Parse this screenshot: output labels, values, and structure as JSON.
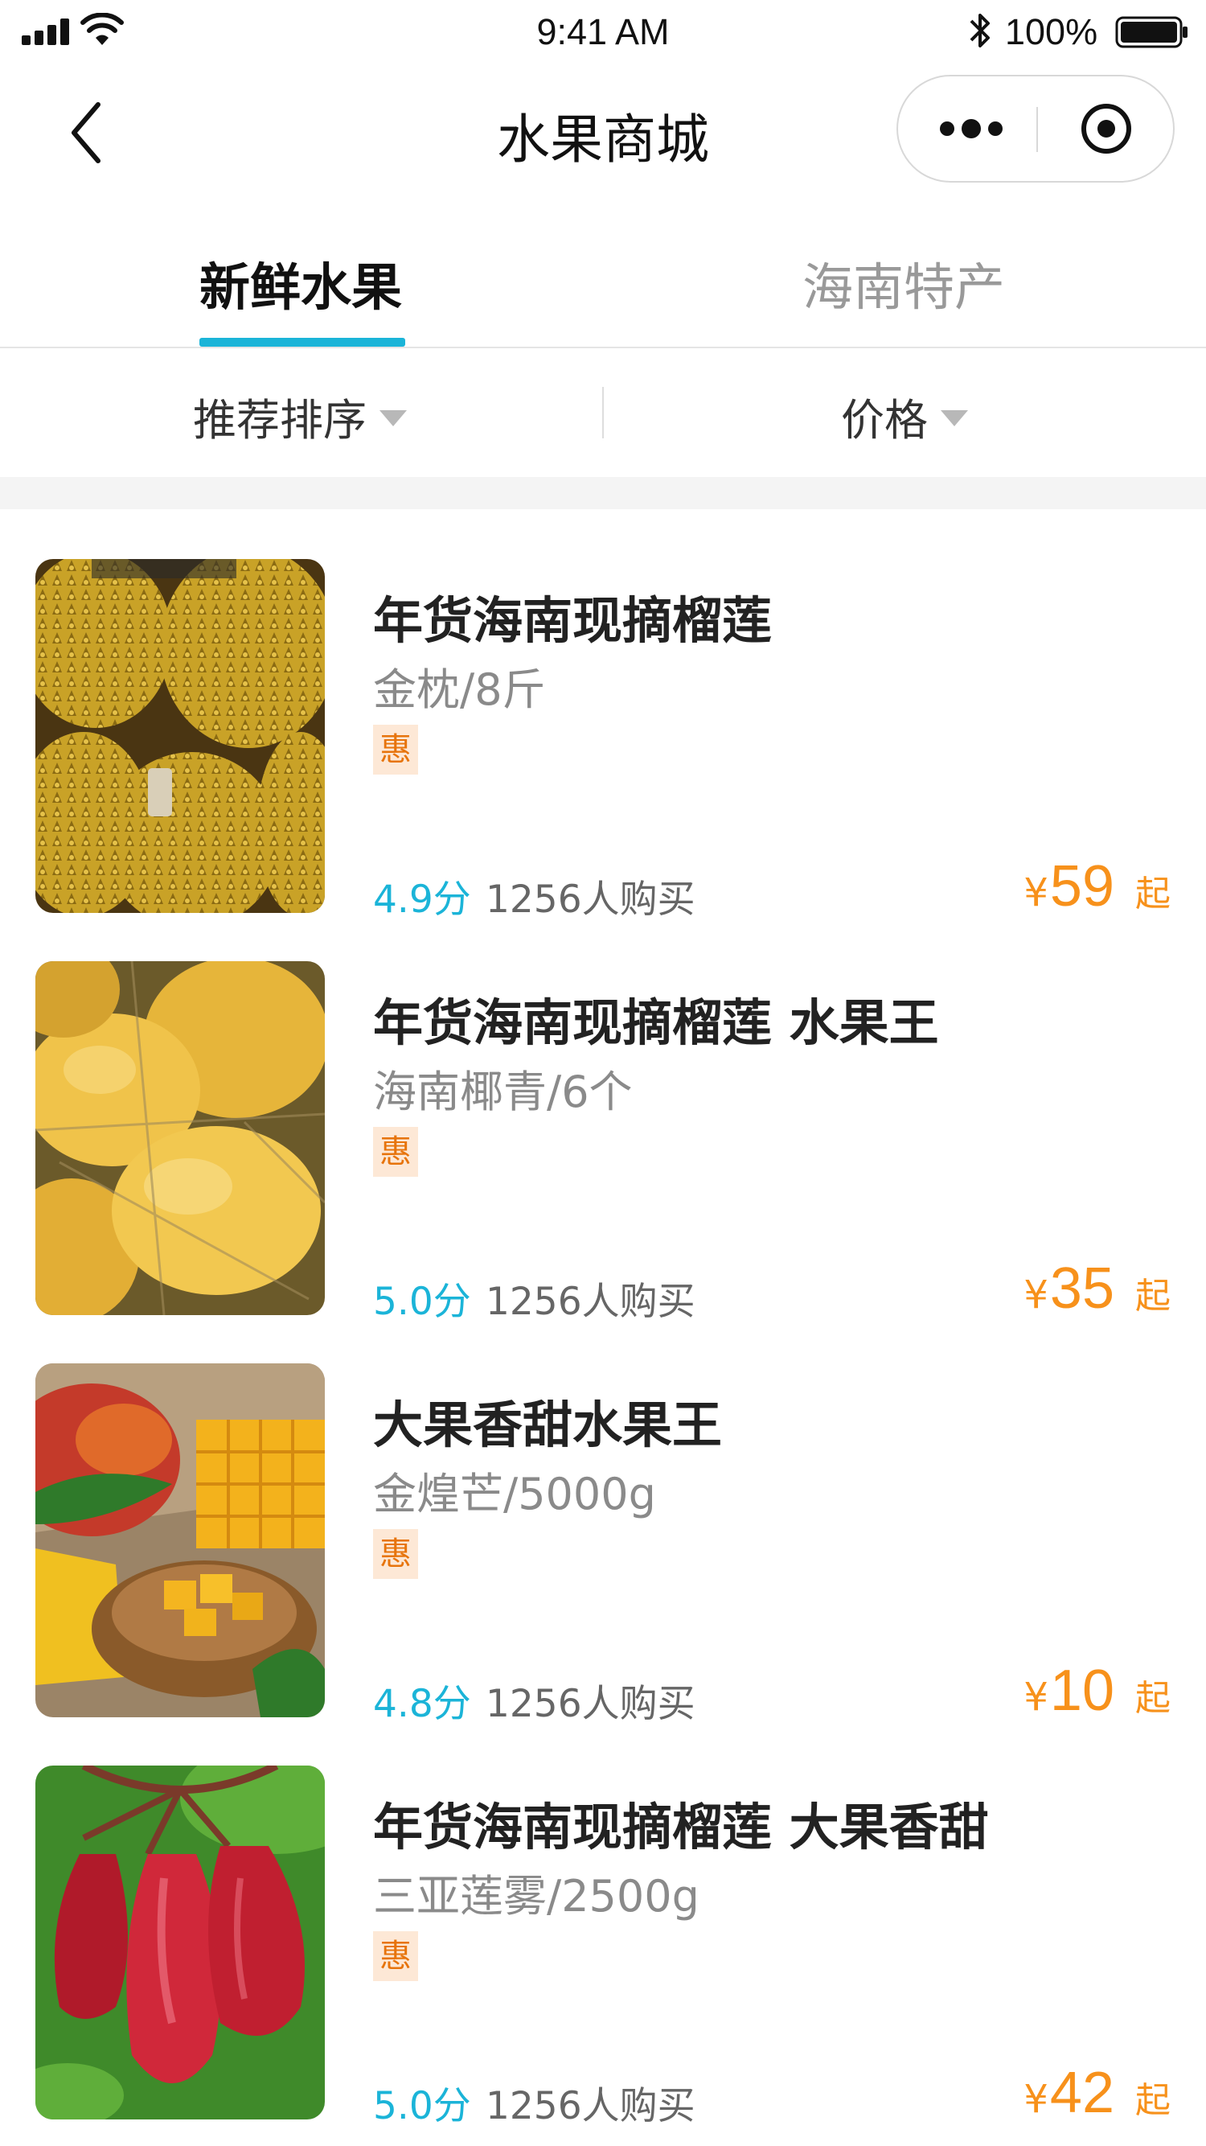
{
  "status_bar": {
    "time": "9:41 AM",
    "battery_percent": "100%",
    "icons": [
      "signal-icon",
      "wifi-icon",
      "bluetooth-icon",
      "battery-icon"
    ]
  },
  "nav": {
    "title": "水果商城",
    "back_icon": "chevron-left-icon",
    "more_icon": "more-dots-icon",
    "close_icon": "target-circle-icon"
  },
  "tabs": [
    {
      "label": "新鲜水果",
      "active": true
    },
    {
      "label": "海南特产",
      "active": false
    }
  ],
  "filters": {
    "sort_label": "推荐排序",
    "price_label": "价格"
  },
  "colors": {
    "accent": "#1bb4d8",
    "price": "#f7911b",
    "tag_bg": "#fde8d6",
    "tag_text": "#e7740c"
  },
  "products": [
    {
      "title": "年货海南现摘榴莲",
      "subtitle": "金枕/8斤",
      "tag": "惠",
      "rating": "4.9分",
      "buyers": "1256人购买",
      "currency": "¥",
      "price": "59",
      "suffix": "起",
      "image": "durian"
    },
    {
      "title": "年货海南现摘榴莲 水果王",
      "subtitle": "海南椰青/6个",
      "tag": "惠",
      "rating": "5.0分",
      "buyers": "1256人购买",
      "currency": "¥",
      "price": "35",
      "suffix": "起",
      "image": "coconut"
    },
    {
      "title": "大果香甜水果王",
      "subtitle": "金煌芒/5000g",
      "tag": "惠",
      "rating": "4.8分",
      "buyers": "1256人购买",
      "currency": "¥",
      "price": "10",
      "suffix": "起",
      "image": "mango"
    },
    {
      "title": "年货海南现摘榴莲 大果香甜",
      "subtitle": "三亚莲雾/2500g",
      "tag": "惠",
      "rating": "5.0分",
      "buyers": "1256人购买",
      "currency": "¥",
      "price": "42",
      "suffix": "起",
      "image": "wax-apple"
    }
  ]
}
